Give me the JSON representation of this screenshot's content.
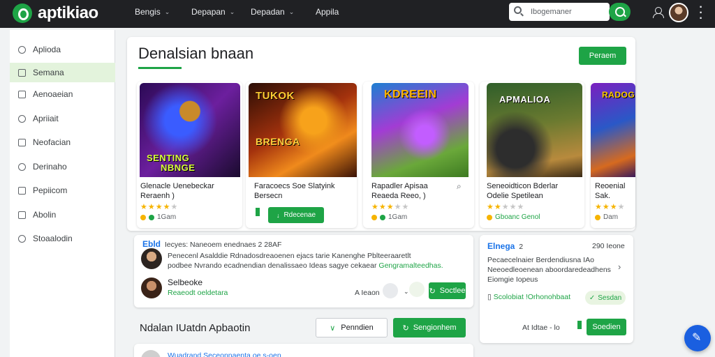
{
  "header": {
    "brand": "aptikiao",
    "nav": [
      "Bengis",
      "Depapan",
      "Depadan",
      "Appila"
    ],
    "search_placeholder": "Ibogemaner"
  },
  "sidebar": {
    "items": [
      {
        "label": "Aplioda",
        "active": false
      },
      {
        "label": "Semana",
        "active": true
      },
      {
        "label": "Aenoaeian",
        "active": false
      },
      {
        "label": "Apriiait",
        "active": false
      },
      {
        "label": "Neofacian",
        "active": false
      },
      {
        "label": "Derinaho",
        "active": false
      },
      {
        "label": "Pepiicom",
        "active": false
      },
      {
        "label": "Abolin",
        "active": false
      },
      {
        "label": "Stoaalodin",
        "active": false
      }
    ]
  },
  "featured": {
    "title": "Denalsian bnaan",
    "action_label": "Peraem",
    "apps": [
      {
        "art_text_1": "SENTING",
        "art_text_2": "NBNGE",
        "name": "Glenacle Uenebeckar",
        "sub": "Reraenh )",
        "rating": 4,
        "meta": "1Gam",
        "has_button": false
      },
      {
        "art_text_1": "TUKOK",
        "art_text_2": "BRENGA",
        "name": "Faracoecs Soe Slatyink",
        "sub": "Bersecn",
        "rating": 0,
        "meta": "",
        "has_button": true,
        "button_label": "Rdecenae"
      },
      {
        "art_text_1": "KDREEIN",
        "art_text_2": "",
        "name": "Rapadler Apisaa",
        "sub": "Reaeda Reeo, )",
        "rating": 3,
        "meta": "1Gam",
        "has_button": false
      },
      {
        "art_text_1": "APMALIOA",
        "art_text_2": "",
        "name": "Seneoidticon Bderlar",
        "sub": "Odelie Spetilean",
        "rating": 2,
        "meta": "Gboanc Genol",
        "has_button": false
      },
      {
        "art_text_1": "RADOGEA",
        "art_text_2": "",
        "name": "Reoenial",
        "sub": "Sak.",
        "rating": 3,
        "meta": "Dam",
        "has_button": false
      }
    ]
  },
  "discussion": {
    "header_user": "Ebld",
    "header_text": "Iecyes: Naneoem enednaes 2 28AF",
    "lines": [
      "Penecenl Asalddie Rdnadosdreaoenen ejacs tarie Kanenghe Pblteeraaretlt",
      "podbee Nvrando ecadnendian denalissaeo Ideas sagye cekaear"
    ],
    "highlight": "Gengramalteedhas.",
    "reply_user": "Selbeoke",
    "reply_sub": "Reaeodt oeldetara",
    "reply_count_label": "A Ieaon",
    "reply_button": "Soctlee"
  },
  "side_card": {
    "title": "Elnega",
    "title_num": "2",
    "date": "290 Ieone",
    "lines": [
      "Pecaecelnaier Berdendiusna IAo",
      "Neeoedleoenean aboordaredeadhens",
      "Eiomgie Iopeus"
    ],
    "line1_highlight": "Berdendiusna",
    "footer_text": "Scolobiat !Orhonohbaat",
    "footer_link": "Sesdan",
    "bottom_meta": "At Idtae - lo",
    "bottom_button": "Soedien"
  },
  "bottom": {
    "title": "Ndalan IUatdn Apbaotin",
    "outline_button": "Penndien",
    "green_button": "Sengionhem",
    "peek_text": "Wuadrand   Seceonnaenta oe s-oen"
  }
}
